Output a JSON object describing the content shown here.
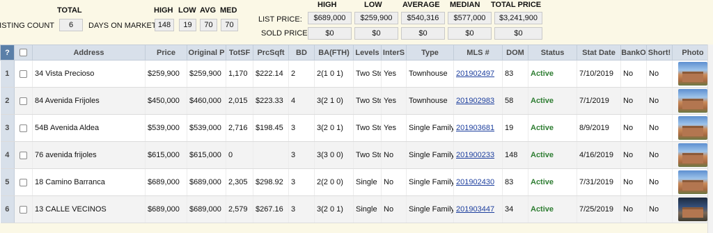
{
  "summary": {
    "listing_count_label": "LISTING COUNT:",
    "total_header": "TOTAL",
    "listing_count": "6",
    "days_on_market_label": "DAYS ON MARKET:",
    "dom_headers": {
      "high": "HIGH",
      "low": "LOW",
      "avg": "AVG",
      "med": "MED"
    },
    "dom_values": {
      "high": "148",
      "low": "19",
      "avg": "70",
      "med": "70"
    },
    "price_headers": {
      "high": "HIGH",
      "low": "LOW",
      "average": "AVERAGE",
      "median": "MEDIAN",
      "total": "TOTAL PRICE"
    },
    "list_price_label": "LIST PRICE:",
    "list_price": {
      "high": "$689,000",
      "low": "$259,900",
      "average": "$540,316",
      "median": "$577,000",
      "total": "$3,241,900"
    },
    "sold_price_label": "SOLD PRICE:",
    "sold_price": {
      "high": "$0",
      "low": "$0",
      "average": "$0",
      "median": "$0",
      "total": "$0"
    }
  },
  "table": {
    "columns": {
      "q": "?",
      "address": "Address",
      "price": "Price",
      "original": "Original P",
      "totsf": "TotSF",
      "prcsqft": "PrcSqft",
      "bd": "BD",
      "ba": "BA(FTH)",
      "levels": "Levels",
      "inters": "InterS",
      "type": "Type",
      "mls": "MLS #",
      "dom": "DOM",
      "status": "Status",
      "statdate": "Stat Date",
      "bank": "BankO",
      "short": "Short!",
      "photo": "Photo"
    },
    "rows": [
      {
        "num": "1",
        "address": "34 Vista Precioso",
        "price": "$259,900",
        "original": "$259,900",
        "totsf": "1,170",
        "prcsqft": "$222.14",
        "bd": "2",
        "ba": "2(1 0 1)",
        "levels": "Two Sto",
        "inters": "Yes",
        "type": "Townhouse",
        "mls": "201902497",
        "dom": "83",
        "status": "Active",
        "statdate": "7/10/2019",
        "bank": "No",
        "short": "No"
      },
      {
        "num": "2",
        "address": "84 Avenida Frijoles",
        "price": "$450,000",
        "original": "$460,000",
        "totsf": "2,015",
        "prcsqft": "$223.33",
        "bd": "4",
        "ba": "3(2 1 0)",
        "levels": "Two Sto",
        "inters": "Yes",
        "type": "Townhouse",
        "mls": "201902983",
        "dom": "58",
        "status": "Active",
        "statdate": "7/1/2019",
        "bank": "No",
        "short": "No"
      },
      {
        "num": "3",
        "address": "54B Avenida Aldea",
        "price": "$539,000",
        "original": "$539,000",
        "totsf": "2,716",
        "prcsqft": "$198.45",
        "bd": "3",
        "ba": "3(2 0 1)",
        "levels": "Two Sto",
        "inters": "Yes",
        "type": "Single Family",
        "mls": "201903681",
        "dom": "19",
        "status": "Active",
        "statdate": "8/9/2019",
        "bank": "No",
        "short": "No"
      },
      {
        "num": "4",
        "address": "76 avenida frijoles",
        "price": "$615,000",
        "original": "$615,000",
        "totsf": "0",
        "prcsqft": "",
        "bd": "3",
        "ba": "3(3 0 0)",
        "levels": "Two Sto",
        "inters": "No",
        "type": "Single Family",
        "mls": "201900233",
        "dom": "148",
        "status": "Active",
        "statdate": "4/16/2019",
        "bank": "No",
        "short": "No"
      },
      {
        "num": "5",
        "address": "18 Camino Barranca",
        "price": "$689,000",
        "original": "$689,000",
        "totsf": "2,305",
        "prcsqft": "$298.92",
        "bd": "3",
        "ba": "2(2 0 0)",
        "levels": "Single",
        "inters": "No",
        "type": "Single Family",
        "mls": "201902430",
        "dom": "83",
        "status": "Active",
        "statdate": "7/31/2019",
        "bank": "No",
        "short": "No"
      },
      {
        "num": "6",
        "address": "13 CALLE VECINOS",
        "price": "$689,000",
        "original": "$689,000",
        "totsf": "2,579",
        "prcsqft": "$267.16",
        "bd": "3",
        "ba": "3(2 0 1)",
        "levels": "Single",
        "inters": "No",
        "type": "Single Family",
        "mls": "201903447",
        "dom": "34",
        "status": "Active",
        "statdate": "7/25/2019",
        "bank": "No",
        "short": "No"
      }
    ]
  },
  "colors": {
    "status_active": "#2e7d32",
    "link": "#1d3f9e",
    "header_bg": "#d8e0ea",
    "page_bg": "#fbf8e6"
  }
}
